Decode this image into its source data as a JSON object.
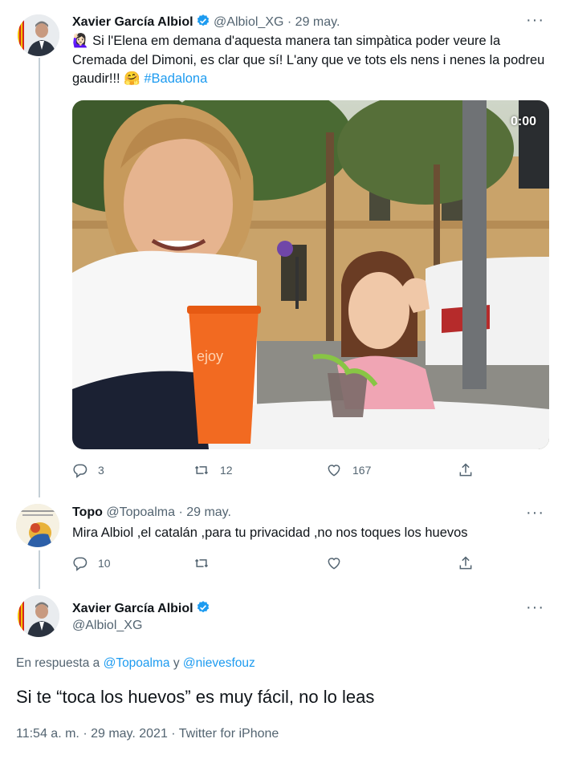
{
  "tweet1": {
    "name": "Xavier García Albiol",
    "handle": "@Albiol_XG",
    "date": "· 29 may.",
    "emoji": "🙋🏻‍♀️",
    "text": "Si l'Elena em demana d'aquesta manera tan simpàtica poder veure la Cremada del Dimoni, es clar que sí! L'any que ve tots els nens i nenes la podreu gaudir!!!",
    "hug_emoji": "🤗",
    "hashtag": "#Badalona",
    "video_timer": "0:00",
    "cup_text": "ejoy",
    "actions": {
      "replies": "3",
      "retweets": "12",
      "likes": "167"
    }
  },
  "tweet2": {
    "name": "Topo",
    "handle": "@Topoalma",
    "date": "· 29 may.",
    "text": "Mira Albiol ,el catalán ,para tu privacidad ,no nos toques los huevos",
    "actions": {
      "replies": "10"
    }
  },
  "tweet3": {
    "name": "Xavier García Albiol",
    "handle": "@Albiol_XG",
    "reply_prefix": "En respuesta a",
    "mention1": "@Topoalma",
    "reply_join": "y",
    "mention2": "@nievesfouz",
    "text": "Si te “toca los huevos” es muy fácil, no lo leas",
    "time": "11:54 a. m.",
    "date": "· 29 may. 2021 ·",
    "source": "Twitter for iPhone"
  },
  "colors": {
    "accent": "#1d9bf0",
    "muted": "#536471",
    "cup": "#f26a21"
  },
  "icons": [
    "verified-badge-icon",
    "more-icon",
    "reply-icon",
    "retweet-icon",
    "like-icon",
    "share-icon"
  ]
}
